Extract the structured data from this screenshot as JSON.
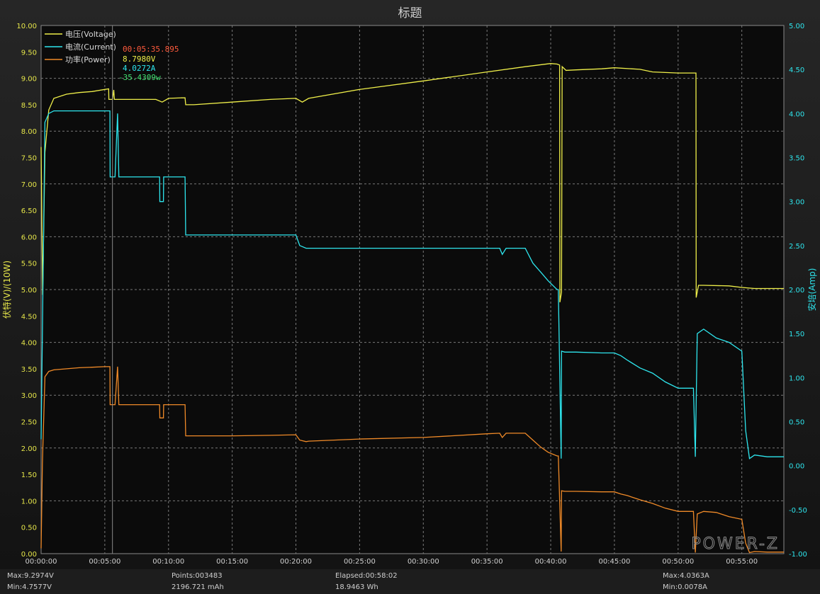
{
  "chart_data": {
    "type": "line",
    "title": "标题",
    "left_axis_label": "伏特(V)/(10W)",
    "right_axis_label": "安培(Amp)",
    "left_ticks": [
      "0.00",
      "0.50",
      "1.00",
      "1.50",
      "2.00",
      "2.50",
      "3.00",
      "3.50",
      "4.00",
      "4.50",
      "5.00",
      "5.50",
      "6.00",
      "6.50",
      "7.00",
      "7.50",
      "8.00",
      "8.50",
      "9.00",
      "9.50",
      "10.00"
    ],
    "right_ticks": [
      "-1.00",
      "-0.50",
      "0.00",
      "0.50",
      "1.00",
      "1.50",
      "2.00",
      "2.50",
      "3.00",
      "3.50",
      "4.00",
      "4.50",
      "5.00"
    ],
    "x_ticks": [
      "00:00:00",
      "00:05:00",
      "00:10:00",
      "00:15:00",
      "00:20:00",
      "00:25:00",
      "00:30:00",
      "00:35:00",
      "00:40:00",
      "00:45:00",
      "00:50:00",
      "00:55:00"
    ],
    "ylim_left": [
      0,
      10
    ],
    "ylim_right": [
      -1,
      5
    ],
    "xlim_minutes": [
      0,
      58.3
    ],
    "grid": true,
    "legend_position": "top-left",
    "colors": {
      "voltage": "#f0f04a",
      "current": "#2ee6ee",
      "power": "#f08a28",
      "cursor_time": "#ff5a3c",
      "cursor_power": "#40e070",
      "left_axis": "#e6e64a",
      "right_axis": "#2ee6ee"
    },
    "series": [
      {
        "name": "电压(Voltage)",
        "axis": "left",
        "key": "voltage",
        "x": [
          0,
          0.12,
          0.3,
          0.6,
          1,
          2,
          3,
          4,
          5,
          5.3,
          5.32,
          5.6,
          5.7,
          5.75,
          6,
          7,
          8,
          9,
          9.5,
          10,
          11,
          11.3,
          11.35,
          12,
          15,
          18,
          20,
          20.5,
          21,
          25,
          30,
          35,
          38,
          40,
          40.5,
          40.7,
          40.72,
          40.85,
          40.9,
          41.2,
          42,
          44,
          45,
          47,
          48,
          50,
          51.4,
          51.42,
          51.6,
          52,
          54,
          55,
          56,
          58.3
        ],
        "y": [
          7.7,
          4.9,
          7.6,
          8.4,
          8.62,
          8.7,
          8.73,
          8.75,
          8.79,
          8.8,
          8.6,
          8.6,
          8.78,
          8.6,
          8.6,
          8.6,
          8.6,
          8.6,
          8.55,
          8.62,
          8.63,
          8.63,
          8.5,
          8.5,
          8.55,
          8.6,
          8.62,
          8.55,
          8.62,
          8.79,
          8.95,
          9.12,
          9.22,
          9.28,
          9.27,
          9.25,
          4.76,
          4.95,
          9.22,
          9.15,
          9.16,
          9.18,
          9.2,
          9.17,
          9.12,
          9.1,
          9.1,
          4.85,
          5.08,
          5.08,
          5.07,
          5.04,
          5.02,
          5.02
        ]
      },
      {
        "name": "电流(Current)",
        "axis": "right",
        "key": "current",
        "x": [
          0,
          0.1,
          0.3,
          0.6,
          1,
          5.4,
          5.42,
          5.8,
          6,
          6.1,
          6.3,
          9.3,
          9.32,
          9.6,
          9.62,
          10.5,
          11,
          11.3,
          11.35,
          15,
          18,
          20,
          20.3,
          20.8,
          21,
          25,
          30,
          35,
          36,
          36.2,
          36.5,
          38,
          38.6,
          39.2,
          39.8,
          40.5,
          40.6,
          40.82,
          40.85,
          41.1,
          42,
          44,
          45,
          45.5,
          46,
          47,
          48,
          49,
          50,
          51.2,
          51.35,
          51.5,
          52,
          53,
          54,
          55,
          55.3,
          55.6,
          56,
          57,
          58.3
        ],
        "y": [
          0.3,
          1.5,
          3.9,
          4.0,
          4.03,
          4.03,
          3.28,
          3.28,
          4.0,
          3.28,
          3.28,
          3.28,
          3.0,
          3.0,
          3.28,
          3.28,
          3.28,
          3.28,
          2.62,
          2.62,
          2.62,
          2.62,
          2.5,
          2.47,
          2.47,
          2.47,
          2.47,
          2.47,
          2.47,
          2.4,
          2.47,
          2.47,
          2.3,
          2.2,
          2.1,
          2.0,
          2.0,
          0.08,
          1.3,
          1.29,
          1.29,
          1.28,
          1.28,
          1.25,
          1.2,
          1.11,
          1.05,
          0.95,
          0.88,
          0.88,
          0.1,
          1.5,
          1.55,
          1.45,
          1.4,
          1.3,
          0.4,
          0.08,
          0.12,
          0.1,
          0.1
        ]
      },
      {
        "name": "功率(Power)",
        "axis": "left",
        "key": "power",
        "x": [
          0,
          0.1,
          0.3,
          0.6,
          1,
          2,
          3,
          4,
          5,
          5.4,
          5.42,
          5.8,
          6,
          6.1,
          6.3,
          9.3,
          9.32,
          9.6,
          9.62,
          10.5,
          11,
          11.3,
          11.35,
          15,
          18,
          20,
          20.3,
          20.8,
          21,
          25,
          30,
          35,
          36,
          36.2,
          36.5,
          38,
          38.6,
          39.2,
          39.8,
          40.5,
          40.6,
          40.82,
          40.85,
          41.1,
          42,
          44,
          45,
          45.5,
          46,
          47,
          48,
          49,
          50,
          51.2,
          51.35,
          51.5,
          52,
          53,
          54,
          55,
          55.3,
          55.6,
          56,
          57,
          58.3
        ],
        "y": [
          0.1,
          1.7,
          3.35,
          3.45,
          3.48,
          3.5,
          3.52,
          3.53,
          3.54,
          3.54,
          2.82,
          2.82,
          3.54,
          2.82,
          2.82,
          2.82,
          2.57,
          2.57,
          2.82,
          2.82,
          2.82,
          2.82,
          2.23,
          2.23,
          2.24,
          2.25,
          2.15,
          2.12,
          2.13,
          2.17,
          2.2,
          2.27,
          2.28,
          2.2,
          2.28,
          2.28,
          2.15,
          2.02,
          1.92,
          1.85,
          1.85,
          0.04,
          1.19,
          1.18,
          1.18,
          1.17,
          1.17,
          1.13,
          1.1,
          1.02,
          0.95,
          0.86,
          0.8,
          0.8,
          0.02,
          0.75,
          0.8,
          0.78,
          0.7,
          0.65,
          0.2,
          0.02,
          0.04,
          0.03,
          0.03
        ]
      }
    ],
    "cursor": {
      "time_text": "00:05:35.895",
      "voltage_text": "8.7980V",
      "current_text": "4.0272A",
      "power_text": "35.4309w",
      "x_minutes": 5.6
    }
  },
  "status": {
    "max_v": "Max:9.2974V",
    "min_v": "Min:4.7577V",
    "points": "Points:003483",
    "mah": "2196.721 mAh",
    "elapsed": "Elapsed:00:58:02",
    "wh": "18.9463 Wh",
    "max_a": "Max:4.0363A",
    "min_a": "Min:0.0078A"
  },
  "watermark": "POWER-Z"
}
